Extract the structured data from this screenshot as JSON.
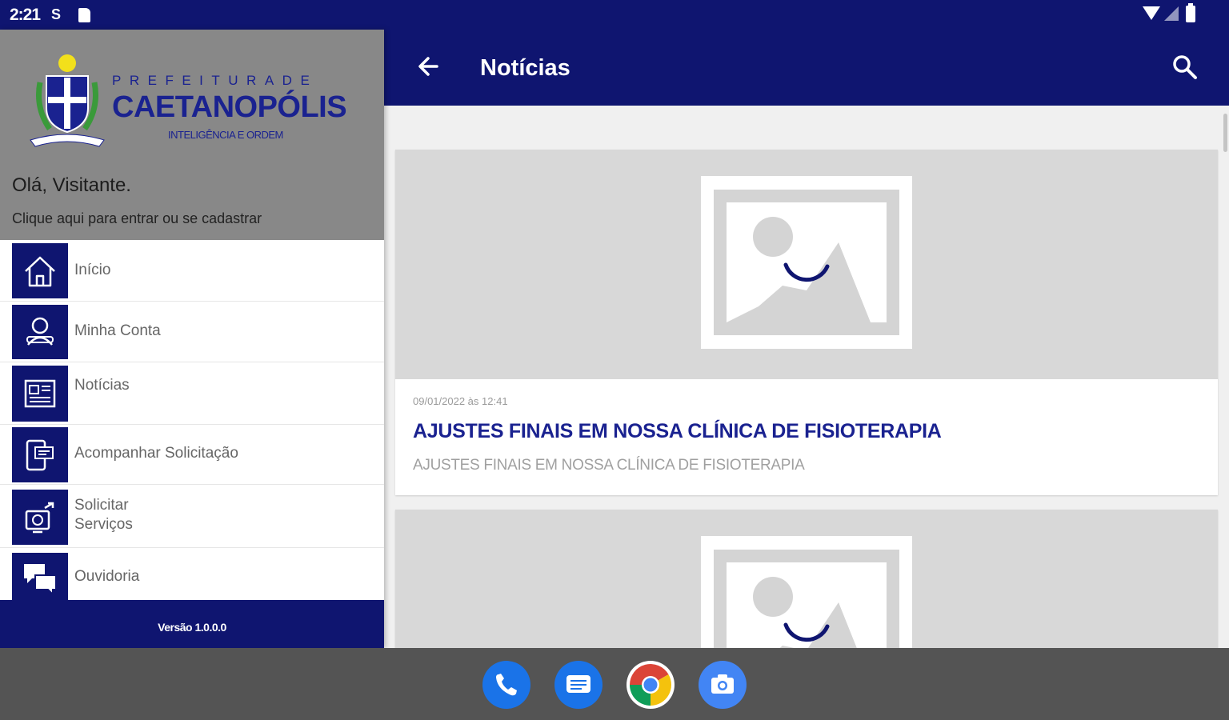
{
  "status_bar": {
    "time": "2:21",
    "indicator": "S",
    "icons": [
      "sd-card-icon",
      "wifi-icon",
      "signal-icon",
      "battery-icon"
    ]
  },
  "app_bar": {
    "title": "Notícias",
    "back_icon": "arrow-back-icon",
    "search_icon": "search-icon",
    "color": "#0f1570"
  },
  "drawer": {
    "logo": {
      "top_text": "PREFEITURADE",
      "name": "CAETANOPÓLIS",
      "tagline": "INTELIGÊNCIA E ORDEM"
    },
    "greeting": "Olá, Visitante.",
    "login_prompt": "Clique aqui para entrar ou se cadastrar",
    "items": [
      {
        "label": "Início",
        "icon": "home-icon"
      },
      {
        "label": "Minha Conta",
        "icon": "account-icon"
      },
      {
        "label": "Notícias",
        "icon": "newspaper-icon"
      },
      {
        "label": "Acompanhar Solicitação",
        "icon": "track-request-icon"
      },
      {
        "label": "Solicitar\nServiços",
        "icon": "request-service-icon"
      },
      {
        "label": "Ouvidoria",
        "icon": "chat-icon"
      }
    ],
    "version": "Versão 1.0.0.0"
  },
  "news": [
    {
      "date": "09/01/2022 às 12:41",
      "title": "AJUSTES FINAIS EM NOSSA CLÍNICA DE FISIOTERAPIA",
      "summary": "AJUSTES FINAIS EM NOSSA CLÍNICA DE FISIOTERAPIA",
      "image": "image-placeholder-icon"
    },
    {
      "image": "image-placeholder-icon"
    }
  ],
  "dock": [
    "phone-icon",
    "messages-icon",
    "chrome-icon",
    "camera-icon"
  ],
  "colors": {
    "primary": "#0f1570",
    "title_blue": "#1a2290",
    "drawer_header": "#888888",
    "nav_bar": "#545454"
  }
}
